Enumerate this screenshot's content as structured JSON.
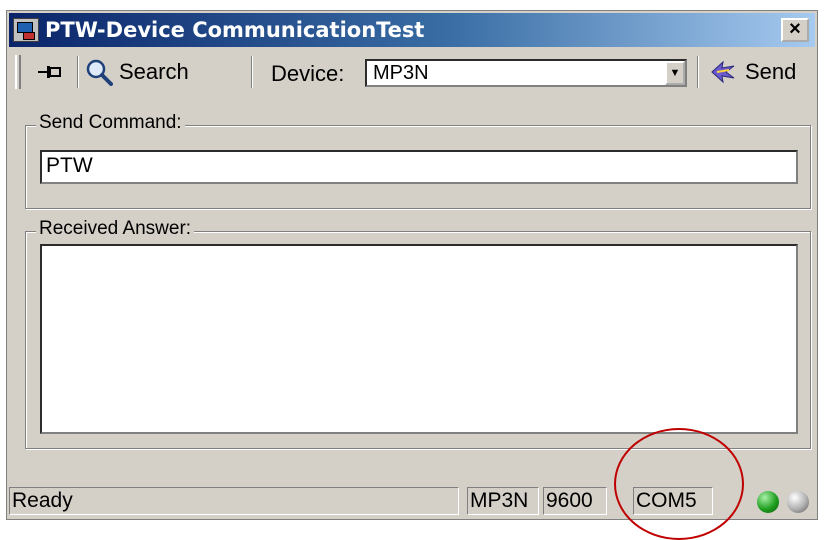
{
  "window": {
    "title": "PTW-Device CommunicationTest",
    "close_label": "×"
  },
  "toolbar": {
    "search_label": "Search",
    "device_label": "Device:",
    "device_value": "MP3N",
    "send_label": "Send"
  },
  "send_command": {
    "label": "Send Command:",
    "value": "PTW"
  },
  "received_answer": {
    "label": "Received Answer:",
    "value": ""
  },
  "statusbar": {
    "status": "Ready",
    "device": "MP3N",
    "baud": "9600",
    "port": "COM5",
    "indicators": [
      {
        "name": "connection-led",
        "color": "#20a020"
      },
      {
        "name": "activity-led",
        "color": "#b0b0b0"
      }
    ]
  },
  "colors": {
    "annotation": "#c00000",
    "titlebar": "#0a246a"
  }
}
